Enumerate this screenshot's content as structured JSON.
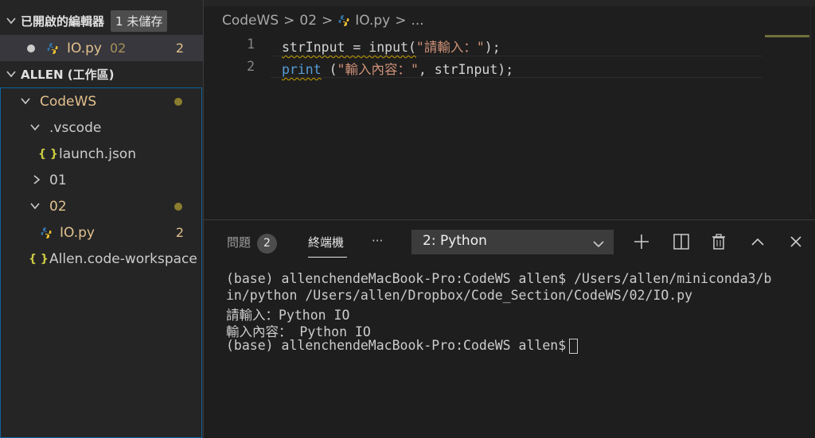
{
  "sidebar": {
    "open_editors_title": "已開啟的編輯器",
    "unsaved_badge": "1 未儲存",
    "open_file": {
      "name": "IO.py",
      "folder": "02",
      "problems": "2"
    },
    "workspace_title": "ALLEN (工作區)",
    "tree": {
      "codews": "CodeWS",
      "vscode": ".vscode",
      "launch": "launch.json",
      "f01": "01",
      "f02": "02",
      "iopy": "IO.py",
      "iopy_problems": "2",
      "workspace_file": "Allen.code-workspace"
    },
    "json_icon_glyph": "{ }"
  },
  "breadcrumb": {
    "part1": "CodeWS",
    "part2": "02",
    "part3": "IO.py",
    "part4": "...",
    "sep": ">"
  },
  "editor": {
    "lines": [
      {
        "no": "1",
        "a": "strInput = input(",
        "b": "\"請輸入：\"",
        "c": ");"
      },
      {
        "no": "2",
        "kw": "print",
        "a": " (",
        "b": "\"輸入內容：\"",
        "c": ", strInput);"
      }
    ]
  },
  "panel": {
    "tab_problems": "問題",
    "problems_count": "2",
    "tab_terminal": "終端機",
    "more": "···",
    "terminal_select": "2: Python",
    "terminal_lines": [
      "(base) allenchendeMacBook-Pro:CodeWS allen$ /Users/allen/miniconda3/b",
      "in/python /Users/allen/Dropbox/Code_Section/CodeWS/02/IO.py",
      "請輸入：Python IO",
      "輸入內容： Python IO",
      "(base) allenchendeMacBook-Pro:CodeWS allen$"
    ]
  },
  "colors": {
    "accent": "#0e639c",
    "modified": "#e2c08d",
    "string": "#ce9178",
    "keyword": "#569cd6"
  }
}
